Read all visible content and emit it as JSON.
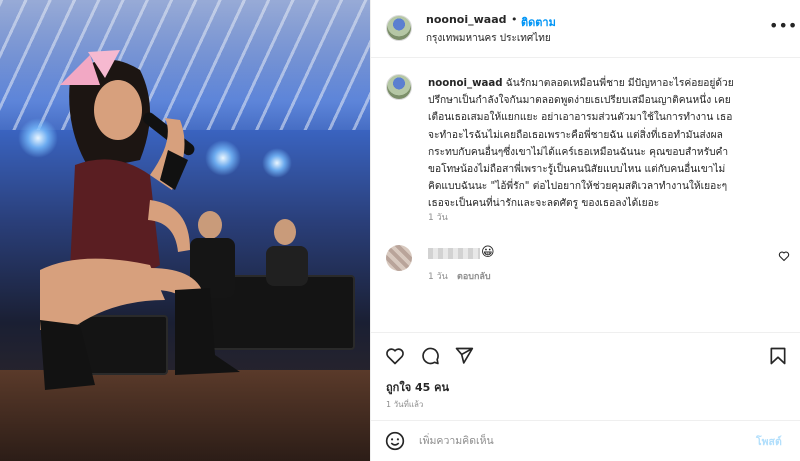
{
  "header": {
    "username": "noonoi_waad",
    "separator": "•",
    "follow_label": "ติดตาม",
    "location": "กรุงเทพมหานคร ประเทศไทย",
    "more_icon": "more-horizontal-icon"
  },
  "caption": {
    "username": "noonoi_waad",
    "text": " ฉันรักมาตลอดเหมือนพี่ชาย มีปัญหาอะไรค่อยอยู่ด้วย\nปรึกษาเป็นกำลังใจกันมาตลอดพูดง่ายเธเปรียบเสมือนญาติคนหนึ่ง เคย\nเตือนเธอเสมอให้แยกแยะ อย่าเอาอารมส่วนตัวมาใช้ในการทำงาน เธอ\nจะทำอะไรฉันไม่เคยถือเธอเพราะคือพี่ชายฉัน แต่สิ่งที่เธอทำมันส่งผล\nกระทบกับคนอื่นๆซึ่งเขาไม่ได้แคร์เธอเหมือนฉันนะ คุณขอบสำหรับคำ\nขอโทษน้องไม่ถือสาพี่เพราะรู้เป็นคนนิสัยแบบไหน แต่กับคนอื่นเขาไม่\nคิดแบบฉันนะ \"ไอ้พี่รัก\" ต่อไปอยากให้ช่วยคุมสติเวลาทำงานให้เยอะๆ\nเธอจะเป็นคนที่น่ารักและจะลดศัตรู ของเธอลงได้เยอะ",
    "time": "1 วัน"
  },
  "comment": {
    "emoji": "😀",
    "time": "1 วัน",
    "reply_label": "ตอบกลับ",
    "heart_icon": "heart-outline-icon"
  },
  "actions": {
    "like_icon": "heart-outline-icon",
    "comment_icon": "comment-bubble-icon",
    "share_icon": "paper-plane-icon",
    "save_icon": "bookmark-icon"
  },
  "likes": "ถูกใจ 45 คน",
  "post_time": "1 วันที่แล้ว",
  "add_comment": {
    "placeholder": "เพิ่มความคิดเห็น",
    "post_label": "โพสต์"
  },
  "colors": {
    "accent": "#0095f6",
    "post_disabled": "#b2dffc",
    "muted": "#8e8e8e",
    "text": "#262626"
  }
}
